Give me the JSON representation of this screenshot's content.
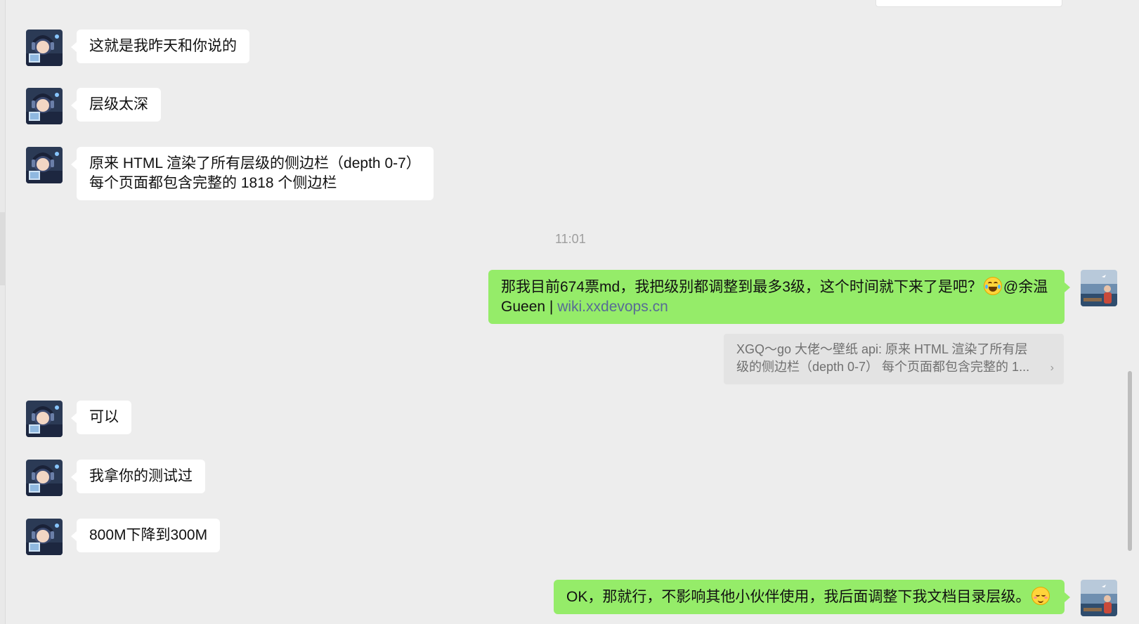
{
  "timestamp": "11:01",
  "incoming_messages": [
    {
      "lines": [
        "这就是我昨天和你说的"
      ]
    },
    {
      "lines": [
        "层级太深"
      ]
    },
    {
      "lines": [
        "原来 HTML 渲染了所有层级的侧边栏（depth 0-7）",
        "每个页面都包含完整的 1818 个侧边栏"
      ]
    },
    {
      "lines": [
        "可以"
      ]
    },
    {
      "lines": [
        "我拿你的测试过"
      ]
    },
    {
      "lines": [
        "800M下降到300M"
      ]
    }
  ],
  "outgoing_message_1": {
    "text_before_emoji": "那我目前674票md，我把级别都调整到最多3级，这个时间就下来了是吧？",
    "emoji": "laughing-with-tears",
    "text_after_emoji": "@余温",
    "line2_prefix": "Gueen | ",
    "link": "wiki.xxdevops.cn"
  },
  "quote": {
    "line1": "XGQ～go 大佬～壁纸 api: 原来 HTML 渲染了所有层",
    "line2": "级的侧边栏（depth 0-7） 每个页面都包含完整的 1...",
    "chevron": "›"
  },
  "outgoing_message_2": {
    "text": "OK，那就行，不影响其他小伙伴使用，我后面调整下我文档目录层级。",
    "emoji": "blushing-smile"
  },
  "colors": {
    "background": "#ededed",
    "incoming_bubble": "#ffffff",
    "outgoing_bubble": "#95ec69",
    "link": "#576b95",
    "timestamp": "#9e9e9e",
    "quote_background": "#e3e3e3"
  },
  "icons": {
    "contact_avatar": "anime-avatar-headphones",
    "self_avatar": "avatar-seaside-photo"
  }
}
